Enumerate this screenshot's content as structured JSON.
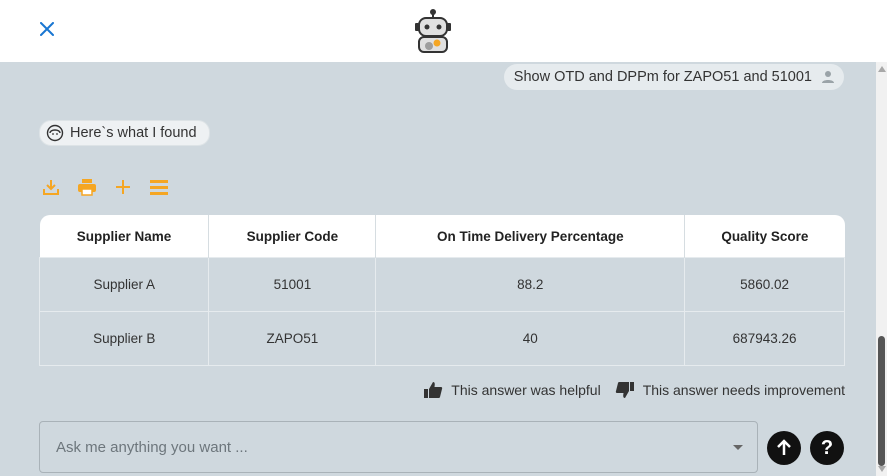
{
  "header": {
    "close_icon": "close-icon",
    "logo": "robot-bot-icon"
  },
  "messages": {
    "user": {
      "text": "Show OTD and DPPm for ZAPO51 and 51001",
      "icon": "user-icon"
    },
    "bot": {
      "text": "Here`s what I found",
      "icon": "support-agent-icon"
    }
  },
  "toolbar": {
    "icons": [
      "download-icon",
      "print-icon",
      "add-icon",
      "list-icon"
    ],
    "color": "#f5a623"
  },
  "table": {
    "headers": [
      "Supplier Name",
      "Supplier Code",
      "On Time Delivery Percentage",
      "Quality Score"
    ],
    "rows": [
      [
        "Supplier A",
        "51001",
        "88.2",
        "5860.02"
      ],
      [
        "Supplier B",
        "ZAPO51",
        "40",
        "687943.26"
      ]
    ]
  },
  "feedback": {
    "helpful": "This answer was helpful",
    "improve": "This answer needs improvement"
  },
  "input": {
    "placeholder": "Ask me anything you want ..."
  },
  "colors": {
    "accent": "#1976d2",
    "chat_bg": "#cfd8de",
    "toolbar": "#f5a623"
  }
}
